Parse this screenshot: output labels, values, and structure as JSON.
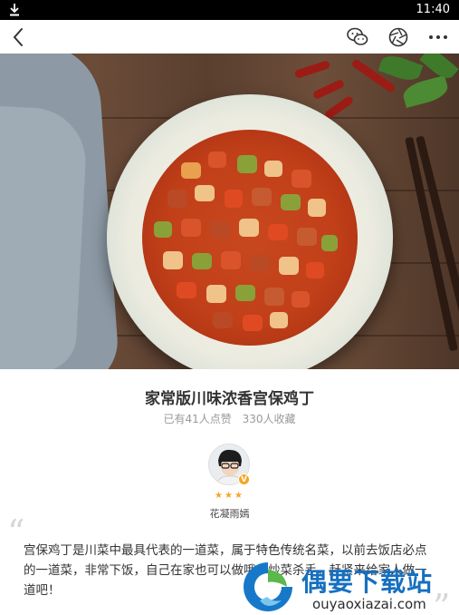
{
  "status_bar": {
    "time": "11:40",
    "download_icon": "download-icon"
  },
  "toolbar": {
    "back_icon": "chevron-left-icon",
    "wechat_icon": "wechat-icon",
    "aperture_icon": "aperture-icon",
    "more_icon": "more-dots-icon"
  },
  "recipe": {
    "title": "家常版川味浓香宫保鸡丁",
    "likes": "已有41人点赞",
    "favorites": "330人收藏",
    "author": "花凝雨嫣",
    "rating_stars": 3,
    "stars_text": "★★★",
    "badge": "V",
    "description": "宫保鸡丁是川菜中最具代表的一道菜，属于特色传统名菜，以前去饭店必点的一道菜，非常下饭，自己在家也可以做哦～炒菜杀手，赶紧来给家人做一道吧！"
  },
  "watermark": {
    "brand": "偶要下载站",
    "url": "ouyaoxiazai.com"
  },
  "colors": {
    "accent": "#f5a623",
    "watermark_blue": "#1670c0"
  }
}
